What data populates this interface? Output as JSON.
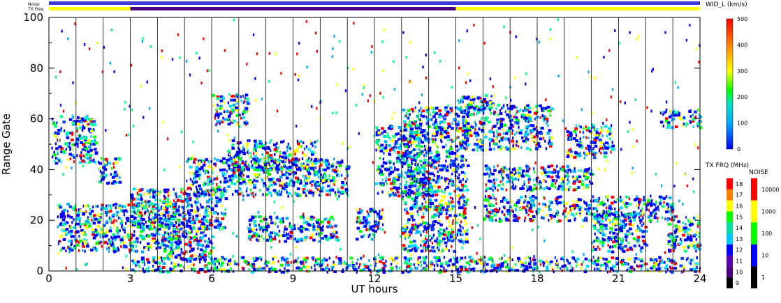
{
  "chart_data": {
    "type": "heatmap",
    "xlabel": "UT hours",
    "ylabel": "Range Gate",
    "xlim": [
      0,
      24
    ],
    "ylim": [
      0,
      100
    ],
    "xticks": [
      "0",
      "3",
      "6",
      "9",
      "12",
      "15",
      "18",
      "21",
      "24"
    ],
    "yticks": [
      "0",
      "20",
      "40",
      "60",
      "80",
      "100"
    ],
    "grid": "vertical lines every hour",
    "top_strips": [
      {
        "label": "Noise"
      },
      {
        "label": "TX Freq",
        "segments": [
          {
            "from": 0,
            "to": 3,
            "color": "#ffff00"
          },
          {
            "from": 3,
            "to": 15,
            "color": "#4b0082"
          },
          {
            "from": 15,
            "to": 24,
            "color": "#ffff00"
          }
        ]
      }
    ],
    "colorbar_main": {
      "title": "WID_L (km/s)",
      "min": 0,
      "max": 500,
      "ticks": [
        "0",
        "100",
        "200",
        "300",
        "400",
        "500"
      ]
    },
    "colorbar_freq": {
      "title": "TX FRQ (MHz)",
      "ticks": [
        "9",
        "10",
        "11",
        "12",
        "13",
        "14",
        "15",
        "16",
        "17",
        "18"
      ],
      "colors": [
        "#000000",
        "#4b0082",
        "#5a00b0",
        "#0000ff",
        "#00c8ff",
        "#00e0a0",
        "#00ff00",
        "#ffff00",
        "#ff8000",
        "#ff0000"
      ]
    },
    "colorbar_noise": {
      "title": "NOISE",
      "ticks": [
        "1",
        "10",
        "100",
        "1000",
        "10000"
      ],
      "colors": [
        "#000000",
        "#0000ff",
        "#00ff00",
        "#ffff00",
        "#ff0000"
      ]
    },
    "scatter_regions": [
      {
        "t0": 0.1,
        "t1": 1.7,
        "g0": 43,
        "g1": 62
      },
      {
        "t0": 0.3,
        "t1": 4.8,
        "g0": 8,
        "g1": 27
      },
      {
        "t0": 1.8,
        "t1": 2.6,
        "g0": 35,
        "g1": 45
      },
      {
        "t0": 3.0,
        "t1": 6.5,
        "g0": 17,
        "g1": 33
      },
      {
        "t0": 5.0,
        "t1": 11.0,
        "g0": 30,
        "g1": 45
      },
      {
        "t0": 6.5,
        "t1": 9.8,
        "g0": 40,
        "g1": 52
      },
      {
        "t0": 4.2,
        "t1": 6.0,
        "g0": 5,
        "g1": 20
      },
      {
        "t0": 3.0,
        "t1": 24.0,
        "g0": 0,
        "g1": 6
      },
      {
        "t0": 7.3,
        "t1": 10.6,
        "g0": 12,
        "g1": 22
      },
      {
        "t0": 11.3,
        "t1": 12.3,
        "g0": 13,
        "g1": 25
      },
      {
        "t0": 12.0,
        "t1": 14.0,
        "g0": 30,
        "g1": 58
      },
      {
        "t0": 13.0,
        "t1": 15.4,
        "g0": 8,
        "g1": 65
      },
      {
        "t0": 15.2,
        "t1": 18.5,
        "g0": 48,
        "g1": 66
      },
      {
        "t0": 16.0,
        "t1": 20.0,
        "g0": 32,
        "g1": 42
      },
      {
        "t0": 16.0,
        "t1": 23.0,
        "g0": 20,
        "g1": 30
      },
      {
        "t0": 19.0,
        "t1": 20.8,
        "g0": 45,
        "g1": 58
      },
      {
        "t0": 20.0,
        "t1": 22.0,
        "g0": 8,
        "g1": 24
      },
      {
        "t0": 22.8,
        "t1": 24.0,
        "g0": 8,
        "g1": 22
      },
      {
        "t0": 22.5,
        "t1": 24.0,
        "g0": 57,
        "g1": 64
      },
      {
        "t0": 6.0,
        "t1": 7.3,
        "g0": 58,
        "g1": 70
      },
      {
        "t0": 15.0,
        "t1": 16.4,
        "g0": 64,
        "g1": 70
      }
    ]
  }
}
